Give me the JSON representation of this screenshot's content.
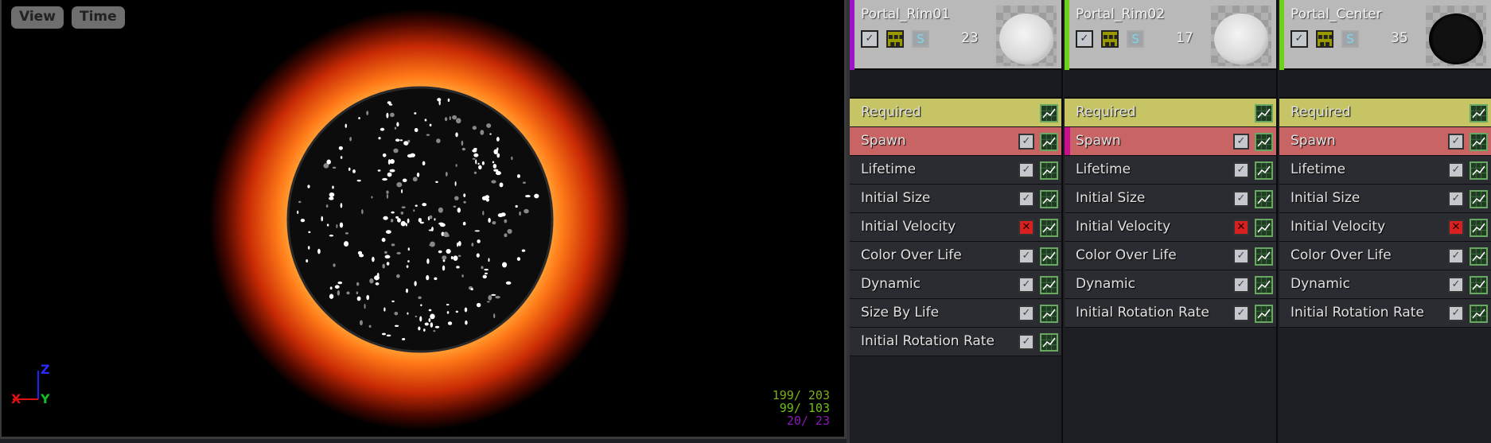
{
  "viewport": {
    "buttons": [
      "View",
      "Time"
    ],
    "axes": {
      "x": "X",
      "y": "Y",
      "z": "Z"
    },
    "stats": [
      {
        "text": "199/ 203",
        "color": "#7fae19"
      },
      {
        "text": "99/ 103",
        "color": "#6fbf19"
      },
      {
        "text": "20/  23",
        "color": "#8a18b8"
      }
    ]
  },
  "emitters": [
    {
      "name": "Portal_Rim01",
      "count": "23",
      "accent": "#9b14c8",
      "thumb": "light",
      "s_label": "S",
      "modules": [
        {
          "label": "Required",
          "type": "req"
        },
        {
          "label": "Spawn",
          "type": "spawn",
          "check": "on"
        },
        {
          "label": "Lifetime",
          "check": "on"
        },
        {
          "label": "Initial Size",
          "check": "on"
        },
        {
          "label": "Initial Velocity",
          "check": "off"
        },
        {
          "label": "Color Over Life",
          "check": "on"
        },
        {
          "label": "Dynamic",
          "check": "on"
        },
        {
          "label": "Size By Life",
          "check": "on"
        },
        {
          "label": "Initial Rotation Rate",
          "check": "on"
        }
      ]
    },
    {
      "name": "Portal_Rim02",
      "count": "17",
      "accent": "#6fd11a",
      "thumb": "light",
      "s_label": "S",
      "modules": [
        {
          "label": "Required",
          "type": "req"
        },
        {
          "label": "Spawn",
          "type": "spawn",
          "check": "on",
          "selected": true
        },
        {
          "label": "Lifetime",
          "check": "on"
        },
        {
          "label": "Initial Size",
          "check": "on"
        },
        {
          "label": "Initial Velocity",
          "check": "off"
        },
        {
          "label": "Color Over Life",
          "check": "on"
        },
        {
          "label": "Dynamic",
          "check": "on"
        },
        {
          "label": "Initial Rotation Rate",
          "check": "on"
        }
      ]
    },
    {
      "name": "Portal_Center",
      "count": "35",
      "accent": "#6fd11a",
      "thumb": "dark",
      "s_label": "S",
      "modules": [
        {
          "label": "Required",
          "type": "req"
        },
        {
          "label": "Spawn",
          "type": "spawn",
          "check": "on"
        },
        {
          "label": "Lifetime",
          "check": "on"
        },
        {
          "label": "Initial Size",
          "check": "on"
        },
        {
          "label": "Initial Velocity",
          "check": "off"
        },
        {
          "label": "Color Over Life",
          "check": "on"
        },
        {
          "label": "Dynamic",
          "check": "on"
        },
        {
          "label": "Initial Rotation Rate",
          "check": "on"
        }
      ]
    }
  ]
}
